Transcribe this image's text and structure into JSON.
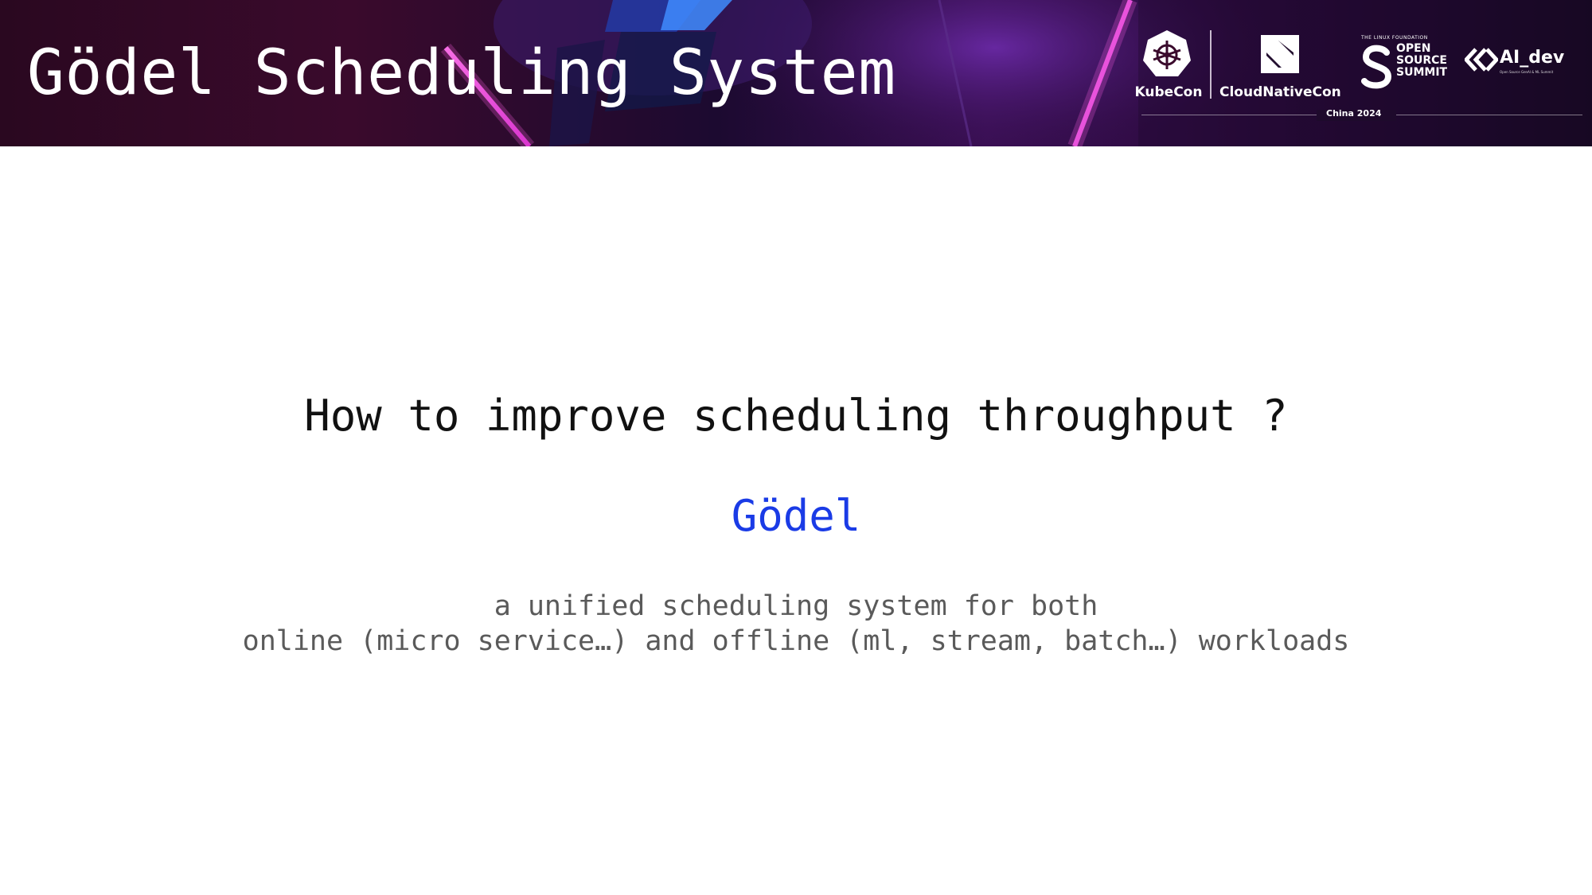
{
  "header": {
    "title": "Gödel Scheduling System",
    "logos": {
      "kubecon": "KubeCon",
      "cloudnativecon": "CloudNativeCon",
      "linux_foundation": "THE LINUX FOUNDATION",
      "open_source_summit": [
        "OPEN",
        "SOURCE",
        "SUMMIT"
      ],
      "ai_dev": "AI_dev",
      "ai_dev_tagline": "Open Source GenAI & ML Summit",
      "event": "China 2024"
    }
  },
  "main": {
    "question": "How to improve scheduling throughput ?",
    "answer": "Gödel",
    "description_lines": [
      "a unified scheduling system for both",
      "online (micro service…) and offline (ml, stream, batch…) workloads"
    ]
  },
  "colors": {
    "answer": "#1a3be6",
    "description": "#5a5a5a",
    "banner_neon": "#ff3fd8"
  }
}
